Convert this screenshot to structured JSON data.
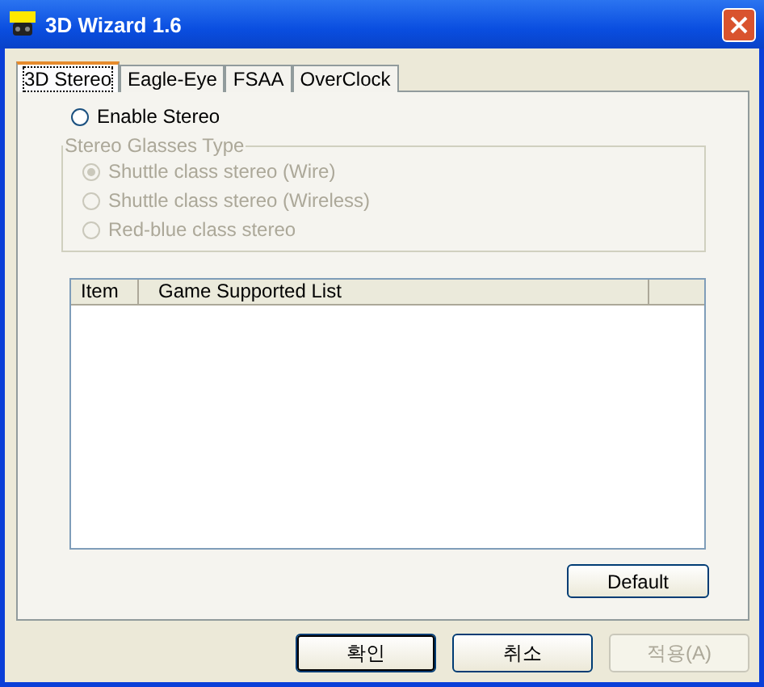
{
  "window": {
    "title": "3D Wizard 1.6"
  },
  "tabs": [
    {
      "label": "3D Stereo",
      "selected": true
    },
    {
      "label": "Eagle-Eye",
      "selected": false
    },
    {
      "label": "FSAA",
      "selected": false
    },
    {
      "label": "OverClock",
      "selected": false
    }
  ],
  "enable_stereo": {
    "label": "Enable Stereo",
    "checked": false
  },
  "glasses_group": {
    "title": "Stereo Glasses Type",
    "disabled": true,
    "options": [
      {
        "label": "Shuttle class stereo (Wire)",
        "selected": true
      },
      {
        "label": "Shuttle class stereo (Wireless)",
        "selected": false
      },
      {
        "label": "Red-blue class stereo",
        "selected": false
      }
    ]
  },
  "table": {
    "columns": [
      "Item",
      "Game Supported List"
    ]
  },
  "default_button": {
    "label": "Default"
  },
  "buttons": [
    {
      "label": "확인",
      "disabled": false,
      "default": true
    },
    {
      "label": "취소",
      "disabled": false,
      "default": false
    },
    {
      "label": "적용(A)",
      "disabled": true,
      "default": false
    }
  ]
}
